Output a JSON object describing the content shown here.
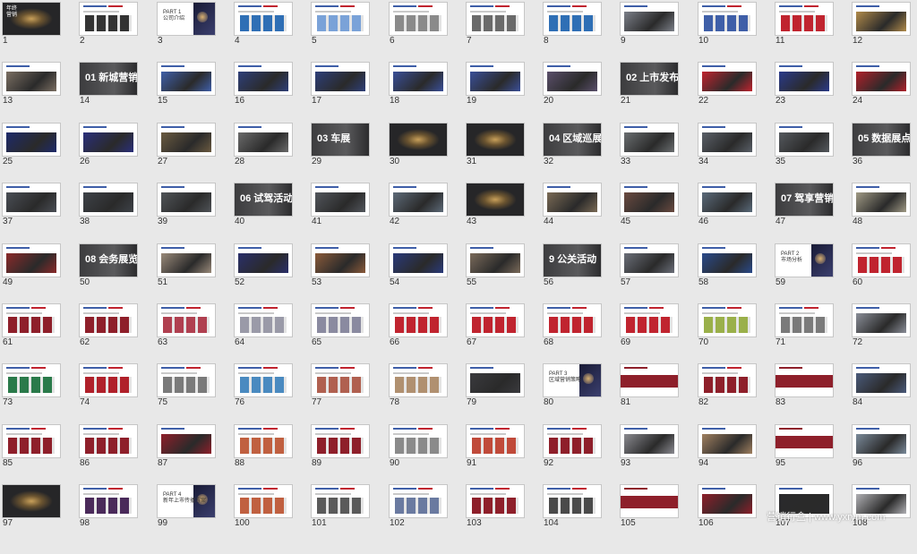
{
  "slides": [
    {
      "n": "1",
      "k": "dark",
      "txt": "年终\n营销"
    },
    {
      "n": "2",
      "k": "light",
      "c": "#333333"
    },
    {
      "n": "3",
      "k": "part",
      "txt": "PART 1\n公司介绍"
    },
    {
      "n": "4",
      "k": "light",
      "c": "#2f6fb5"
    },
    {
      "n": "5",
      "k": "light",
      "c": "#7aa2d8"
    },
    {
      "n": "6",
      "k": "light",
      "c": "#8a8a8a"
    },
    {
      "n": "7",
      "k": "light",
      "c": "#6a6a6a"
    },
    {
      "n": "8",
      "k": "light",
      "c": "#2f6fb5"
    },
    {
      "n": "9",
      "k": "photo",
      "c": "#7b7f88"
    },
    {
      "n": "10",
      "k": "light",
      "c": "#3f5fa8"
    },
    {
      "n": "11",
      "k": "light",
      "c": "#c0242f"
    },
    {
      "n": "12",
      "k": "photo",
      "c": "#b08a4a"
    },
    {
      "n": "13",
      "k": "photo",
      "c": "#7a6e62"
    },
    {
      "n": "14",
      "k": "section",
      "txt": "01 新城营销"
    },
    {
      "n": "15",
      "k": "photo",
      "c": "#3f5fa8"
    },
    {
      "n": "16",
      "k": "photo",
      "c": "#2e3f78"
    },
    {
      "n": "17",
      "k": "photo",
      "c": "#2e3f78"
    },
    {
      "n": "18",
      "k": "photo",
      "c": "#3a4f98"
    },
    {
      "n": "19",
      "k": "photo",
      "c": "#3a4f98"
    },
    {
      "n": "20",
      "k": "photo",
      "c": "#5a4f6a"
    },
    {
      "n": "21",
      "k": "section",
      "txt": "02 上市发布会"
    },
    {
      "n": "22",
      "k": "photo",
      "c": "#c0242f"
    },
    {
      "n": "23",
      "k": "photo",
      "c": "#2a3a8a"
    },
    {
      "n": "24",
      "k": "photo",
      "c": "#b0202a"
    },
    {
      "n": "25",
      "k": "photo",
      "c": "#1e2a6a"
    },
    {
      "n": "26",
      "k": "photo",
      "c": "#2a2f7a"
    },
    {
      "n": "27",
      "k": "photo",
      "c": "#6a5a40"
    },
    {
      "n": "28",
      "k": "photo",
      "c": "#6a6a6a"
    },
    {
      "n": "29",
      "k": "section",
      "txt": "03 车展"
    },
    {
      "n": "30",
      "k": "dark",
      "txt": ""
    },
    {
      "n": "31",
      "k": "dark",
      "txt": ""
    },
    {
      "n": "32",
      "k": "section",
      "txt": "04 区域巡展"
    },
    {
      "n": "33",
      "k": "photo",
      "c": "#6a6e70"
    },
    {
      "n": "34",
      "k": "photo",
      "c": "#5a6068"
    },
    {
      "n": "35",
      "k": "photo",
      "c": "#55595e"
    },
    {
      "n": "36",
      "k": "section",
      "txt": "05 数据展点"
    },
    {
      "n": "37",
      "k": "photo",
      "c": "#4a4e55"
    },
    {
      "n": "38",
      "k": "photo",
      "c": "#3e4248"
    },
    {
      "n": "39",
      "k": "photo",
      "c": "#505458"
    },
    {
      "n": "40",
      "k": "section",
      "txt": "06 试驾活动"
    },
    {
      "n": "41",
      "k": "photo",
      "c": "#52565c"
    },
    {
      "n": "42",
      "k": "photo",
      "c": "#5d6a78"
    },
    {
      "n": "43",
      "k": "dark",
      "txt": ""
    },
    {
      "n": "44",
      "k": "photo",
      "c": "#7a6a55"
    },
    {
      "n": "45",
      "k": "photo",
      "c": "#6a4a40"
    },
    {
      "n": "46",
      "k": "photo",
      "c": "#5a6a7a"
    },
    {
      "n": "47",
      "k": "section",
      "txt": "07 驾享营销"
    },
    {
      "n": "48",
      "k": "photo",
      "c": "#a09a85"
    },
    {
      "n": "49",
      "k": "photo",
      "c": "#8a2a2a"
    },
    {
      "n": "50",
      "k": "section",
      "txt": "08 会务展览"
    },
    {
      "n": "51",
      "k": "photo",
      "c": "#9a8a7a"
    },
    {
      "n": "52",
      "k": "photo",
      "c": "#2a2f6a"
    },
    {
      "n": "53",
      "k": "photo",
      "c": "#8a5a3a"
    },
    {
      "n": "54",
      "k": "photo",
      "c": "#2a3a7a"
    },
    {
      "n": "55",
      "k": "photo",
      "c": "#7a6a5a"
    },
    {
      "n": "56",
      "k": "section",
      "txt": "9 公关活动"
    },
    {
      "n": "57",
      "k": "photo",
      "c": "#6a6e78"
    },
    {
      "n": "58",
      "k": "photo",
      "c": "#2a4a8a"
    },
    {
      "n": "59",
      "k": "part",
      "txt": "PART 2\n市场分析"
    },
    {
      "n": "60",
      "k": "light",
      "c": "#c0242f"
    },
    {
      "n": "61",
      "k": "light",
      "c": "#8e1f2a"
    },
    {
      "n": "62",
      "k": "light",
      "c": "#8e1f2a"
    },
    {
      "n": "63",
      "k": "light",
      "c": "#b04050"
    },
    {
      "n": "64",
      "k": "light",
      "c": "#9a9aa8"
    },
    {
      "n": "65",
      "k": "light",
      "c": "#8a8aa0"
    },
    {
      "n": "66",
      "k": "light",
      "c": "#c0242f"
    },
    {
      "n": "67",
      "k": "light",
      "c": "#c0242f"
    },
    {
      "n": "68",
      "k": "light",
      "c": "#c0242f"
    },
    {
      "n": "69",
      "k": "light",
      "c": "#c0242f"
    },
    {
      "n": "70",
      "k": "light",
      "c": "#9ab04a"
    },
    {
      "n": "71",
      "k": "light",
      "c": "#7a7a7a"
    },
    {
      "n": "72",
      "k": "photo",
      "c": "#8a8e98"
    },
    {
      "n": "73",
      "k": "light",
      "c": "#2a7a4a"
    },
    {
      "n": "74",
      "k": "light",
      "c": "#b0202a"
    },
    {
      "n": "75",
      "k": "light",
      "c": "#7a7a7a"
    },
    {
      "n": "76",
      "k": "light",
      "c": "#4a8ac0"
    },
    {
      "n": "77",
      "k": "light",
      "c": "#b06050"
    },
    {
      "n": "78",
      "k": "light",
      "c": "#b09070"
    },
    {
      "n": "79",
      "k": "photo",
      "c": "#3a3a3e"
    },
    {
      "n": "80",
      "k": "part",
      "txt": "PART 3\n区域营销策略"
    },
    {
      "n": "81",
      "k": "redsl"
    },
    {
      "n": "82",
      "k": "light",
      "c": "#8e1f2a"
    },
    {
      "n": "83",
      "k": "redsl"
    },
    {
      "n": "84",
      "k": "photo",
      "c": "#4a5a7a"
    },
    {
      "n": "85",
      "k": "light",
      "c": "#8e1f2a"
    },
    {
      "n": "86",
      "k": "light",
      "c": "#8e1f2a"
    },
    {
      "n": "87",
      "k": "photo",
      "c": "#8e1f2a"
    },
    {
      "n": "88",
      "k": "light",
      "c": "#c06040"
    },
    {
      "n": "89",
      "k": "light",
      "c": "#8e1f2a"
    },
    {
      "n": "90",
      "k": "light",
      "c": "#8a8a8a"
    },
    {
      "n": "91",
      "k": "light",
      "c": "#c04a3a"
    },
    {
      "n": "92",
      "k": "light",
      "c": "#8e1f2a"
    },
    {
      "n": "93",
      "k": "photo",
      "c": "#8a8a90"
    },
    {
      "n": "94",
      "k": "photo",
      "c": "#a08060"
    },
    {
      "n": "95",
      "k": "redsl"
    },
    {
      "n": "96",
      "k": "photo",
      "c": "#7a8a9a"
    },
    {
      "n": "97",
      "k": "dark",
      "txt": ""
    },
    {
      "n": "98",
      "k": "light",
      "c": "#4a2a5a"
    },
    {
      "n": "99",
      "k": "part",
      "txt": "PART 4\n新年上市传播方案"
    },
    {
      "n": "100",
      "k": "light",
      "c": "#c06040"
    },
    {
      "n": "101",
      "k": "light",
      "c": "#5a5a5a"
    },
    {
      "n": "102",
      "k": "light",
      "c": "#6a7aa0"
    },
    {
      "n": "103",
      "k": "light",
      "c": "#8e1f2a"
    },
    {
      "n": "104",
      "k": "light",
      "c": "#4a4a4a"
    },
    {
      "n": "105",
      "k": "redsl"
    },
    {
      "n": "106",
      "k": "photo",
      "c": "#8e1f2a"
    },
    {
      "n": "107",
      "k": "photo",
      "c": "#2a2a2c"
    },
    {
      "n": "108",
      "k": "photo",
      "c": "#b0b0b4"
    }
  ],
  "watermark": "营销行盒 | www.yxrym.com"
}
